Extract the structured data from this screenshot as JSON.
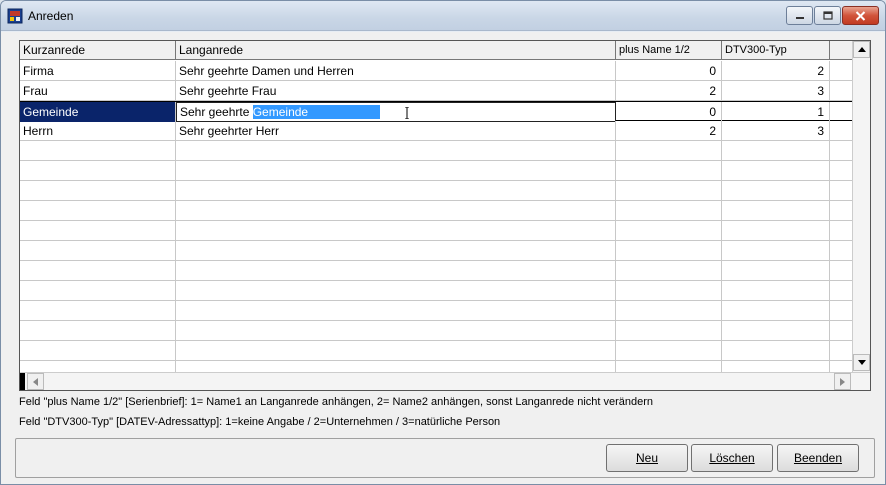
{
  "window": {
    "title": "Anreden"
  },
  "grid": {
    "columns": [
      "Kurzanrede",
      "Langanrede",
      "plus Name 1/2",
      "DTV300-Typ"
    ],
    "rows": [
      {
        "kurz": "Firma",
        "lang": "Sehr geehrte Damen und Herren",
        "plus": "0",
        "typ": "2"
      },
      {
        "kurz": "Frau",
        "lang": "Sehr geehrte Frau",
        "plus": "2",
        "typ": "3"
      },
      {
        "kurz": "Gemeinde",
        "lang_prefix": "Sehr geehrte ",
        "lang_selected": "Gemeinde",
        "plus": "0",
        "typ": "1"
      },
      {
        "kurz": "Herrn",
        "lang": "Sehr geehrter Herr",
        "plus": "2",
        "typ": "3"
      }
    ],
    "selected_row_index": 2
  },
  "info": {
    "line1": "Feld \"plus Name 1/2\" [Serienbrief]: 1= Name1 an Langanrede anhängen, 2= Name2 anhängen, sonst Langanrede nicht verändern",
    "line2": "Feld \"DTV300-Typ\" [DATEV-Adressattyp]: 1=keine Angabe / 2=Unternehmen / 3=natürliche Person"
  },
  "buttons": {
    "neu": "Neu",
    "loeschen": "Löschen",
    "beenden": "Beenden"
  },
  "colors": {
    "selection": "#0a246a",
    "text_selection": "#3399ff"
  }
}
